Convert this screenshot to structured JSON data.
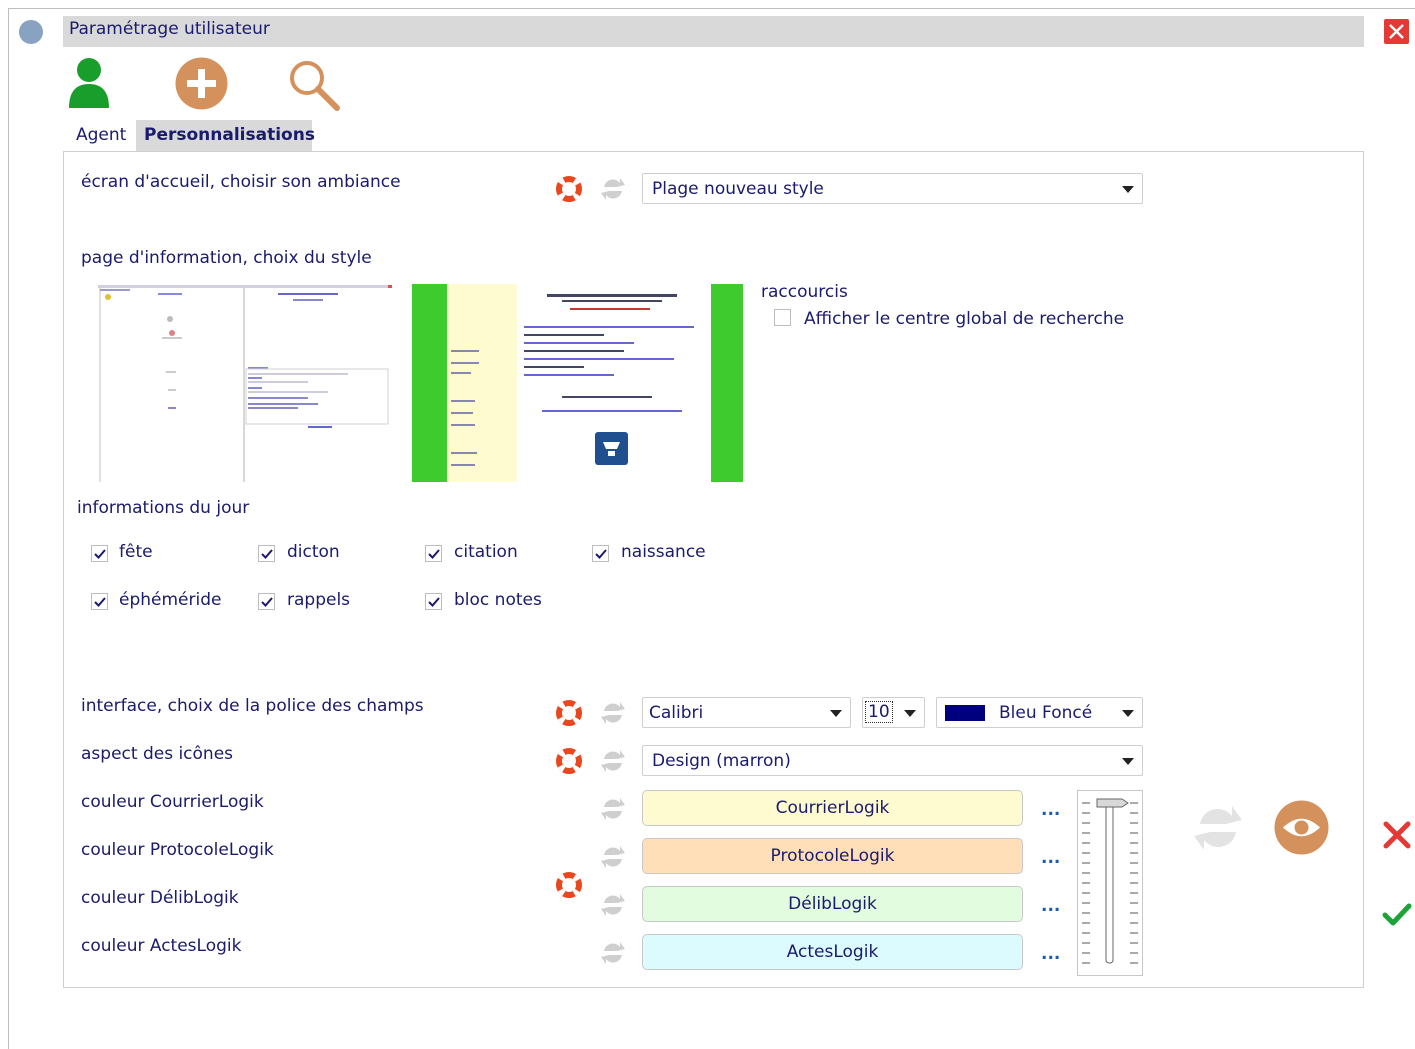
{
  "window": {
    "title": "Paramétrage utilisateur"
  },
  "toolbar": {
    "user_icon": "user-icon",
    "add_icon": "add-circle-icon",
    "search_icon": "search-icon"
  },
  "tabs": [
    {
      "label": "Agent",
      "active": false
    },
    {
      "label": "Personnalisations",
      "active": true
    }
  ],
  "ambiance": {
    "label": "écran d'accueil, choisir son ambiance",
    "value": "Plage nouveau style"
  },
  "info_style": {
    "label": "page d'information, choix du style"
  },
  "shortcuts": {
    "label": "raccourcis",
    "option_label": "Afficher le centre global de recherche",
    "option_checked": false
  },
  "daily_info": {
    "label": "informations du jour",
    "items": [
      {
        "label": "fête",
        "checked": true
      },
      {
        "label": "dicton",
        "checked": true
      },
      {
        "label": "citation",
        "checked": true
      },
      {
        "label": "naissance",
        "checked": true
      },
      {
        "label": "éphéméride",
        "checked": true
      },
      {
        "label": "rappels",
        "checked": true
      },
      {
        "label": "bloc notes",
        "checked": true
      }
    ]
  },
  "font": {
    "label": "interface, choix de la police des champs",
    "family": "Calibri",
    "size": "10",
    "color_name": "Bleu Foncé",
    "color_hex": "#00007f"
  },
  "icons_aspect": {
    "label": "aspect des icônes",
    "value": "Design (marron)"
  },
  "app_colors": [
    {
      "label": "couleur CourrierLogik",
      "button": "CourrierLogik",
      "color": "#fffbd0"
    },
    {
      "label": "couleur ProtocoleLogik",
      "button": "ProtocoleLogik",
      "color": "#ffdfb8"
    },
    {
      "label": "couleur DélibLogik",
      "button": "DélibLogik",
      "color": "#e2fce0"
    },
    {
      "label": "couleur ActesLogik",
      "button": "ActesLogik",
      "color": "#dcfbff"
    }
  ],
  "more_label": "...",
  "colors": {
    "accent_brown": "#d4915c",
    "green_user": "#1a9e2b",
    "close_red": "#e53935",
    "ok_green": "#1ea338",
    "text_blue": "#1a1a6e"
  }
}
